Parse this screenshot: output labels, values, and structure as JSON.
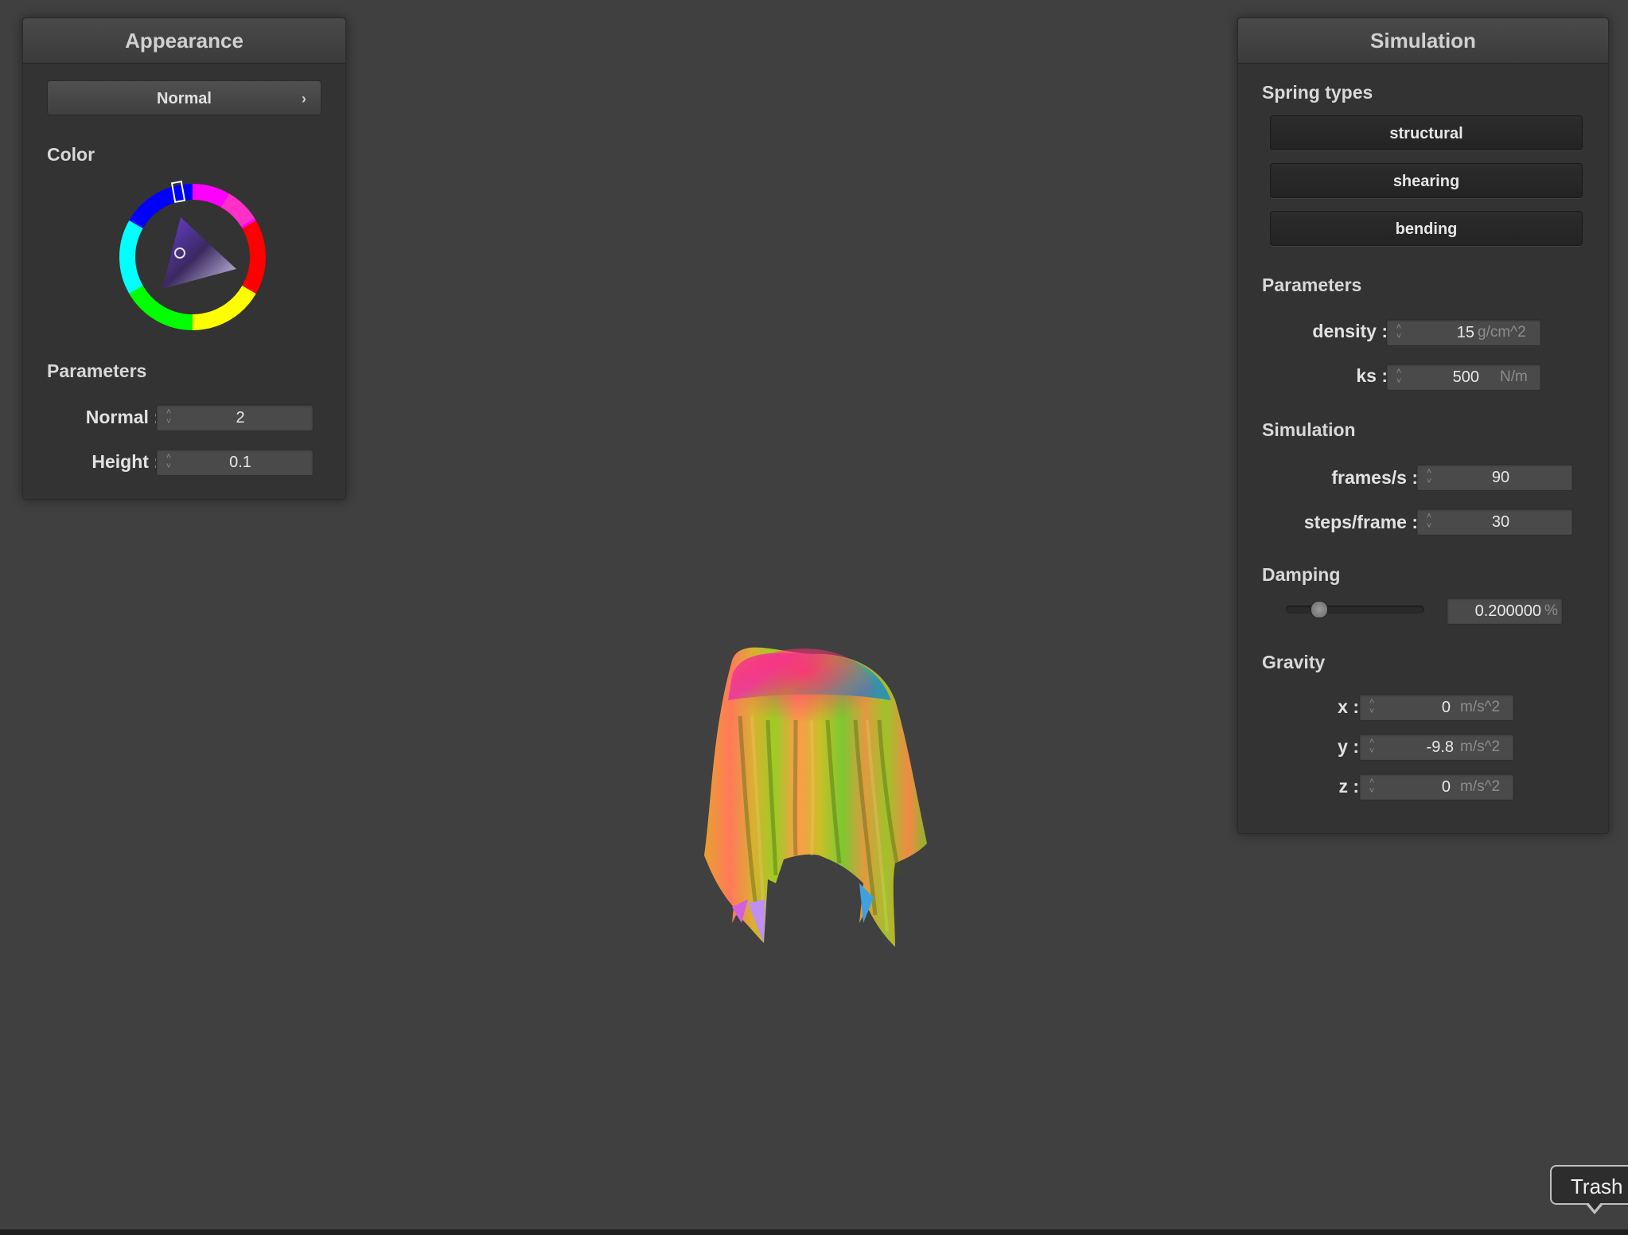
{
  "appearance": {
    "title": "Appearance",
    "mode_label": "Normal",
    "color_label": "Color",
    "parameters_label": "Parameters",
    "normal_label": "Normal :",
    "normal_value": "2",
    "height_label": "Height :",
    "height_value": "0.1",
    "selected_color": "#6a3fd6"
  },
  "simulation": {
    "title": "Simulation",
    "spring_types_label": "Spring types",
    "springs": [
      "structural",
      "shearing",
      "bending"
    ],
    "parameters_label": "Parameters",
    "density_label": "density :",
    "density_value": "15",
    "density_unit": "g/cm^2",
    "ks_label": "ks :",
    "ks_value": "500",
    "ks_unit": "N/m",
    "simulation_label": "Simulation",
    "fps_label": "frames/s :",
    "fps_value": "90",
    "steps_label": "steps/frame :",
    "steps_value": "30",
    "damping_label": "Damping",
    "damping_value": "0.200000",
    "damping_unit": "%",
    "damping_slider_fraction": 0.2,
    "gravity_label": "Gravity",
    "gx_label": "x :",
    "gx_value": "0",
    "gy_label": "y :",
    "gy_value": "-9.8",
    "gz_label": "z :",
    "gz_value": "0",
    "gravity_unit": "m/s^2"
  },
  "tooltip": {
    "text": "Trash"
  }
}
